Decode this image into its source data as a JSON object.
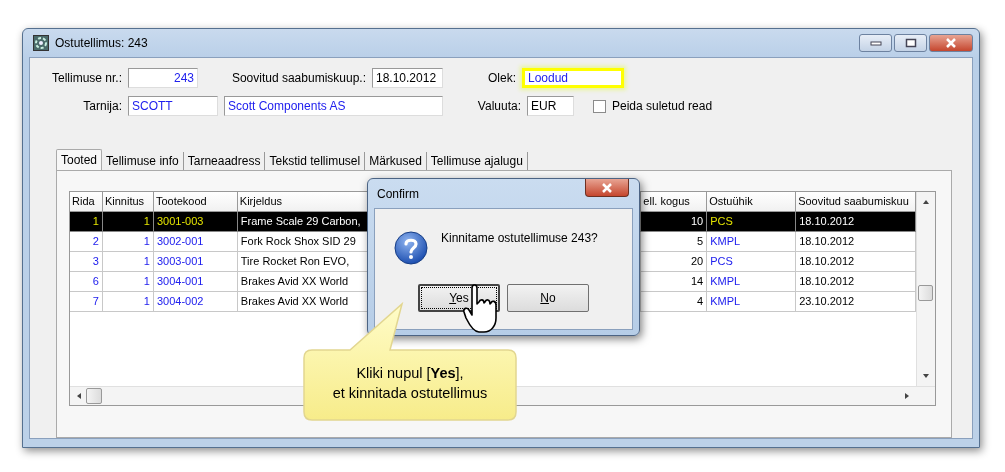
{
  "window": {
    "title": "Ostutellimus: 243"
  },
  "form": {
    "order_no": {
      "label": "Tellimuse nr.:",
      "value": "243"
    },
    "desired_date": {
      "label": "Soovitud saabumiskuup.:",
      "value": "18.10.2012"
    },
    "status": {
      "label": "Olek:",
      "value": "Loodud",
      "highlighted": true
    },
    "supplier": {
      "label": "Tarnija:",
      "code": "SCOTT",
      "name": "Scott Components AS"
    },
    "currency": {
      "label": "Valuuta:",
      "value": "EUR"
    },
    "hide_closed": {
      "label": "Peida suletud read",
      "checked": false
    }
  },
  "tabs": [
    {
      "label": "Tooted",
      "selected": true
    },
    {
      "label": "Tellimuse info",
      "selected": false
    },
    {
      "label": "Tarneaadress",
      "selected": false
    },
    {
      "label": "Tekstid tellimusel",
      "selected": false
    },
    {
      "label": "Märkused",
      "selected": false
    },
    {
      "label": "Tellimuse ajalugu",
      "selected": false
    }
  ],
  "table": {
    "columns": [
      "Rida",
      "Kinnitus",
      "Tootekood",
      "Kirjeldus",
      "ell. kogus",
      "Ostuühik",
      "Soovitud saabumiskuu"
    ],
    "rows": [
      {
        "selected": true,
        "cells": [
          "1",
          "1",
          "3001-003",
          "Frame Scale 29 Carbon,",
          "10",
          "PCS",
          "18.10.2012"
        ]
      },
      {
        "selected": false,
        "cells": [
          "2",
          "1",
          "3002-001",
          "Fork Rock Shox SID 29",
          "5",
          "KMPL",
          "18.10.2012"
        ]
      },
      {
        "selected": false,
        "cells": [
          "3",
          "1",
          "3003-001",
          "Tire Rocket Ron EVO,",
          "20",
          "PCS",
          "18.10.2012"
        ]
      },
      {
        "selected": false,
        "cells": [
          "6",
          "1",
          "3004-001",
          "Brakes Avid XX World",
          "14",
          "KMPL",
          "18.10.2012"
        ]
      },
      {
        "selected": false,
        "cells": [
          "7",
          "1",
          "3004-002",
          "Brakes Avid XX World",
          "4",
          "KMPL",
          "23.10.2012"
        ]
      }
    ]
  },
  "dialog": {
    "title": "Confirm",
    "message": "Kinnitame ostutellimuse 243?",
    "buttons": [
      {
        "label": "Yes",
        "default": true
      },
      {
        "label": "No",
        "default": false
      }
    ]
  },
  "callout": {
    "text": "Kliki nupul [**Yes**],\net kinnitada ostutellimus"
  }
}
